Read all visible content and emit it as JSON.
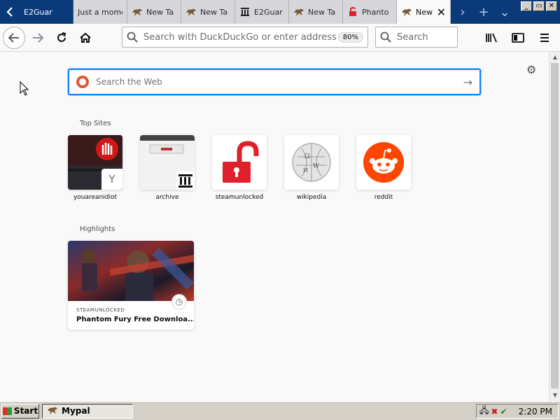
{
  "window": {
    "controls": [
      "_",
      "▭",
      "✕"
    ]
  },
  "tabs": [
    {
      "label": "E2Guar",
      "icon": "shield-icon",
      "style": "dark"
    },
    {
      "label": "Just a mome",
      "icon": "",
      "style": "light"
    },
    {
      "label": "New Ta",
      "icon": "mypal-icon",
      "style": "light"
    },
    {
      "label": "New Ta",
      "icon": "mypal-icon",
      "style": "light"
    },
    {
      "label": "E2Guar",
      "icon": "archive-icon",
      "style": "light"
    },
    {
      "label": "New Ta",
      "icon": "mypal-icon",
      "style": "light"
    },
    {
      "label": "Phanto",
      "icon": "padlock-icon",
      "style": "light"
    },
    {
      "label": "New",
      "icon": "mypal-icon",
      "style": "selected"
    }
  ],
  "navbar": {
    "url_placeholder": "Search with DuckDuckGo or enter address",
    "zoom": "80%",
    "search_placeholder": "Search"
  },
  "newtab": {
    "search_placeholder": "Search the Web",
    "top_sites_title": "Top Sites",
    "highlights_title": "Highlights",
    "top_sites": [
      {
        "label": "youareanidiot",
        "badge": "Y"
      },
      {
        "label": "archive"
      },
      {
        "label": "steamunlocked"
      },
      {
        "label": "wikipedia"
      },
      {
        "label": "reddit"
      }
    ],
    "highlight": {
      "source": "STEAMUNLOCKED",
      "title": "Phantom Fury Free Downloa..."
    }
  },
  "taskbar": {
    "start_label": "Start",
    "task_label": "Mypal",
    "clock": "2:20 PM"
  },
  "colors": {
    "tabstrip": "#0a3a7a",
    "accent_blue": "#0a84ff",
    "reddit": "#ff4500",
    "steam_lock": "#e0202a"
  }
}
